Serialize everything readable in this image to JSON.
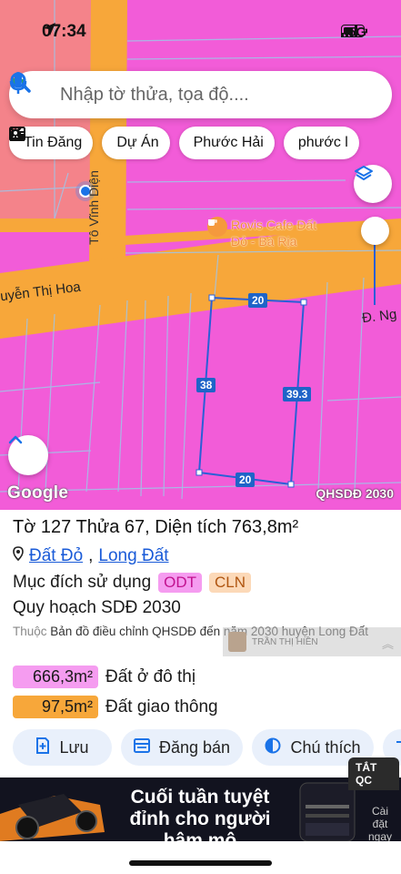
{
  "status_bar": {
    "time": "07:34",
    "network": "5G"
  },
  "search": {
    "placeholder": "Nhập tờ thửa, tọa độ...."
  },
  "chips": [
    {
      "label": "Tin Đăng",
      "icon": "newspaper-icon"
    },
    {
      "label": "Dự Án",
      "icon": "buildings-icon"
    },
    {
      "label": "Phước Hải",
      "icon": "close-icon"
    },
    {
      "label": "phước l",
      "icon": "close-icon"
    }
  ],
  "map": {
    "streets": {
      "to_vinh_dien": "Tô Vĩnh Diện",
      "nguyen_thi_hoa": "uyễn Thị Hoa",
      "d_ng": "Đ. Ng"
    },
    "poi": {
      "name_line1": "Rovis Cafe Đất",
      "name_line2": "Đỏ - Bà Rịa"
    },
    "parcel_dimensions": {
      "top": "20",
      "left": "38",
      "right": "39.3",
      "bottom": "20"
    },
    "google": "Google",
    "plan_label": "QHSDĐ 2030"
  },
  "parcel": {
    "title_prefix": "Tờ",
    "sheet_no": "127",
    "lot_prefix": "Thửa",
    "lot_no": "67",
    "area_prefix": "Diện tích",
    "area": "763,8m²",
    "district": "Đất Đỏ",
    "ward": "Long Đất",
    "purpose_label": "Mục đích sử dụng",
    "purpose_codes": [
      "ODT",
      "CLN"
    ],
    "plan_title": "Quy hoạch SDĐ 2030",
    "source_prefix": "Thuộc",
    "source_text": "Bản đồ điều chỉnh QHSDĐ đến năm 2030 huyện Long Đất",
    "zones": [
      {
        "area": "666,3m²",
        "label": "Đất ở đô thị",
        "color": "#f59cf0"
      },
      {
        "area": "97,5m²",
        "label": "Đất giao thông",
        "color": "#f7a73a"
      }
    ]
  },
  "actions": [
    {
      "label": "Lưu",
      "icon": "bookmark-add-icon"
    },
    {
      "label": "Đăng bán",
      "icon": "listing-icon"
    },
    {
      "label": "Chú thích",
      "icon": "contrast-icon"
    }
  ],
  "watermark": "TRẦN THỊ HIỀN",
  "ad": {
    "close_label": "TẮT QC",
    "headline": "Cuối tuần tuyệt đỉnh cho người hâm mộ",
    "side_text": "Cài đặt ngay"
  },
  "colors": {
    "residential": "#f25cd8",
    "road": "#f7a73a",
    "accent": "#1a73e8",
    "parcel_border": "#2a5fd6"
  }
}
